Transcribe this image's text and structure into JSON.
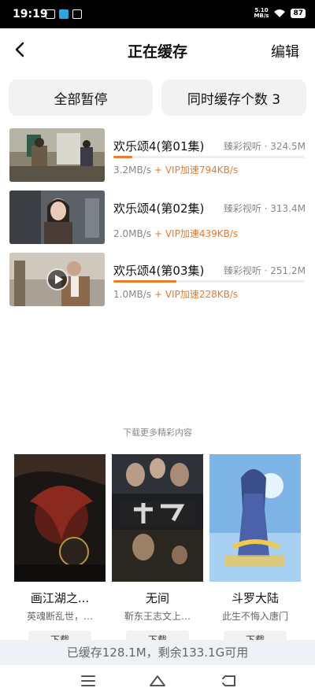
{
  "status": {
    "time": "19:19",
    "net_speed_value": "5.10",
    "net_speed_unit": "MB/s",
    "battery": "87"
  },
  "header": {
    "title": "正在缓存",
    "edit": "编辑"
  },
  "actions": {
    "pause_all": "全部暂停",
    "concurrent": "同时缓存个数 3"
  },
  "downloads": [
    {
      "title": "欢乐颂4(第01集)",
      "source": "臻彩视听",
      "size": "324.5M",
      "speed": "3.2MB/s",
      "vip": "+ VIP加速794KB/s",
      "progress": 0.1
    },
    {
      "title": "欢乐颂4(第02集)",
      "source": "臻彩视听",
      "size": "313.4M",
      "speed": "2.0MB/s",
      "vip": "+ VIP加速439KB/s",
      "progress": 0.0
    },
    {
      "title": "欢乐颂4(第03集)",
      "source": "臻彩视听",
      "size": "251.2M",
      "speed": "1.0MB/s",
      "vip": "+ VIP加速228KB/s",
      "progress": 0.33
    }
  ],
  "recommend": {
    "title": "下载更多精彩内容",
    "items": [
      {
        "name": "画江湖之...",
        "desc": "英魂断乱世，…",
        "button": "下载"
      },
      {
        "name": "无间",
        "desc": "靳东王志文上…",
        "button": "下载"
      },
      {
        "name": "斗罗大陆",
        "desc": "此生不悔入唐门",
        "button": "下载"
      }
    ]
  },
  "footer": {
    "storage": "已缓存128.1M，剩余133.1G可用"
  },
  "colors": {
    "accent": "#f07828",
    "button_bg": "#f2f2f2",
    "storage_bg": "#eef1f6"
  }
}
